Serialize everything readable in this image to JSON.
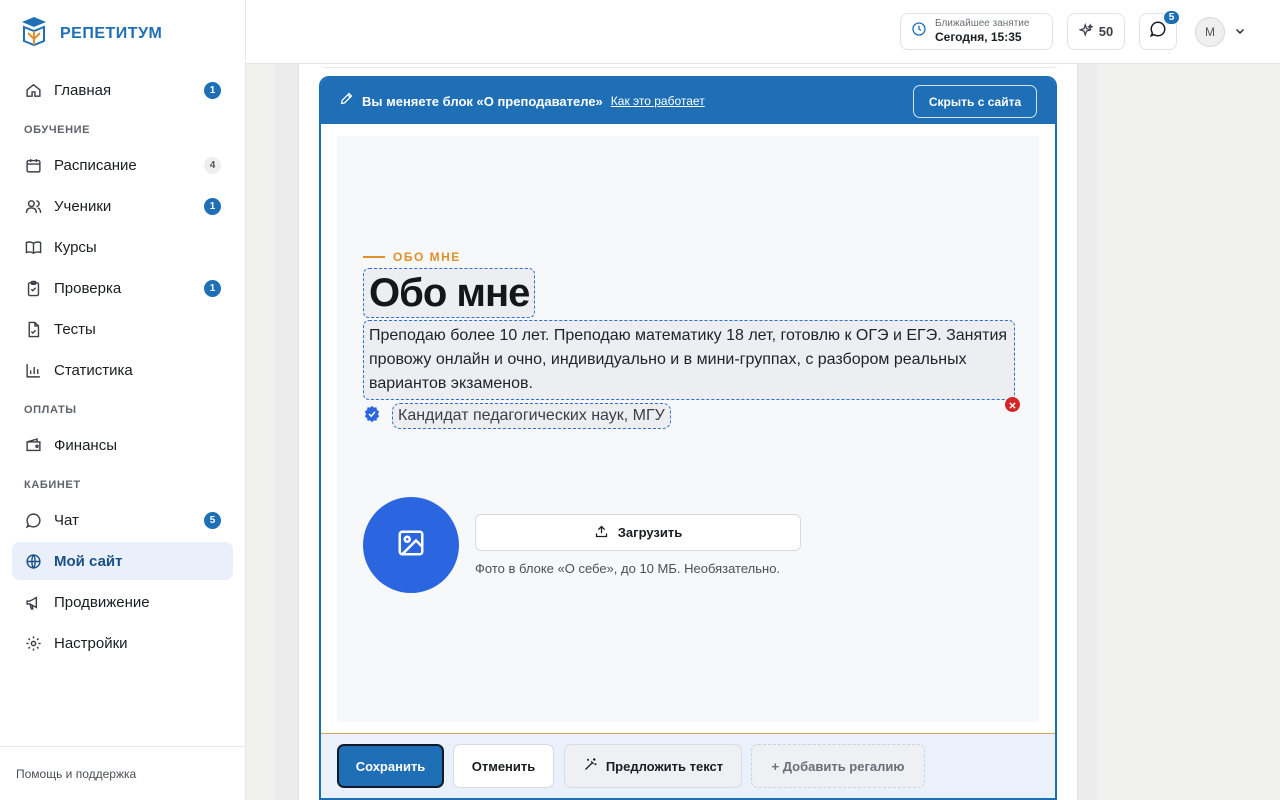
{
  "brand": {
    "name": "РЕПЕТИТУМ"
  },
  "nav": {
    "home": {
      "label": "Главная",
      "badge": "1"
    },
    "section_learning": "ОБУЧЕНИЕ",
    "schedule": {
      "label": "Расписание",
      "badge": "4"
    },
    "students": {
      "label": "Ученики",
      "badge": "1"
    },
    "courses": {
      "label": "Курсы"
    },
    "review": {
      "label": "Проверка",
      "badge": "1"
    },
    "tests": {
      "label": "Тесты"
    },
    "stats": {
      "label": "Статистика"
    },
    "section_payments": "ОПЛАТЫ",
    "finance": {
      "label": "Финансы"
    },
    "section_cabinet": "КАБИНЕТ",
    "chat": {
      "label": "Чат",
      "badge": "5"
    },
    "mysite": {
      "label": "Мой сайт"
    },
    "promo": {
      "label": "Продвижение"
    },
    "settings": {
      "label": "Настройки"
    }
  },
  "help": "Помощь и поддержка",
  "topbar": {
    "next_lesson_label": "Ближайшее занятие",
    "next_lesson_time": "Сегодня, 15:35",
    "points": "50",
    "chat_badge": "5",
    "avatar_initial": "М"
  },
  "editor": {
    "banner_title": "Вы меняете блок «О преподавателе»",
    "how_it_works": "Как это работает",
    "hide_button": "Скрыть с сайта",
    "eyebrow": "ОБО МНЕ",
    "heading": "Обо мне",
    "about_text": "Преподаю более 10 лет. Преподаю математику 18 лет, готовлю к ОГЭ и ЕГЭ. Занятия провожу онлайн и очно, индивидуально и в мини-группах, с разбором реальных вариантов экзаменов.",
    "regalia": "Кандидат педагогических наук, МГУ",
    "upload_button": "Загрузить",
    "upload_hint": "Фото в блоке «О себе», до 10 МБ. Необязательно.",
    "save": "Сохранить",
    "cancel": "Отменить",
    "suggest": "Предложить текст",
    "add_regalia": "+ Добавить регалию"
  },
  "colors": {
    "accent": "#1f6fb6",
    "eyebrow": "#e0902a",
    "photo": "#2b66e0",
    "danger": "#d32727"
  }
}
